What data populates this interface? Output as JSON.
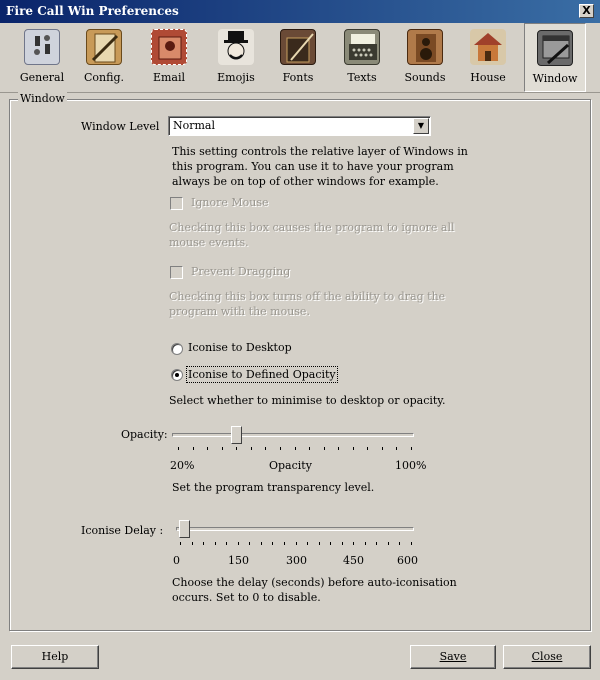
{
  "window": {
    "title": "Fire Call Win Preferences",
    "close_glyph": "X"
  },
  "toolbar": {
    "items": [
      {
        "label": "General",
        "icon": "switch-panel-icon",
        "color": "#8a8fa0"
      },
      {
        "label": "Config.",
        "icon": "clipboard-pencil-icon",
        "color": "#a07a3c"
      },
      {
        "label": "Email",
        "icon": "stamp-icon",
        "color": "#9c3a2a"
      },
      {
        "label": "Emojis",
        "icon": "monopoly-man-icon",
        "color": "#3a3a3a"
      },
      {
        "label": "Fonts",
        "icon": "book-quill-icon",
        "color": "#5a4030"
      },
      {
        "label": "Texts",
        "icon": "typewriter-icon",
        "color": "#6a6a5a"
      },
      {
        "label": "Sounds",
        "icon": "speaker-cabinet-icon",
        "color": "#8a5a3a"
      },
      {
        "label": "House",
        "icon": "house-icon",
        "color": "#a0502a"
      },
      {
        "label": "Window",
        "icon": "window-gear-icon",
        "color": "#4a4a4a"
      }
    ],
    "selected": "Window"
  },
  "group": {
    "legend": "Window"
  },
  "window_level": {
    "label": "Window Level",
    "value": "Normal",
    "description_1": "This setting controls the relative layer of Windows in",
    "description_2": "this program. You can use it to have your program",
    "description_3": "always be on top of other windows for example."
  },
  "ignore_mouse": {
    "label": "Ignore Mouse",
    "checked": false,
    "enabled": false,
    "description_1": "Checking this box causes the program to ignore all",
    "description_2": "mouse events."
  },
  "prevent_dragging": {
    "label": "Prevent Dragging",
    "checked": false,
    "enabled": false,
    "description_1": "Checking this box turns off the ability to drag the",
    "description_2": "program with the mouse."
  },
  "iconise": {
    "option_desktop": "Iconise to Desktop",
    "option_opacity": "Iconise to Defined Opacity",
    "selected": "Iconise to Defined Opacity",
    "description": "Select whether to minimise to desktop or opacity."
  },
  "opacity": {
    "label": "Opacity:",
    "min_label": "20%",
    "mid_label": "Opacity",
    "max_label": "100%",
    "value_fraction": 0.27,
    "description": "Set the program transparency level."
  },
  "iconise_delay": {
    "label": "Iconise Delay :",
    "ticks": [
      "0",
      "150",
      "300",
      "450",
      "600"
    ],
    "value": 10,
    "max": 600,
    "description_1": "Choose the delay (seconds) before auto-iconisation",
    "description_2": "occurs. Set to 0 to disable."
  },
  "buttons": {
    "help": "Help",
    "save": "Save",
    "close": "Close"
  }
}
